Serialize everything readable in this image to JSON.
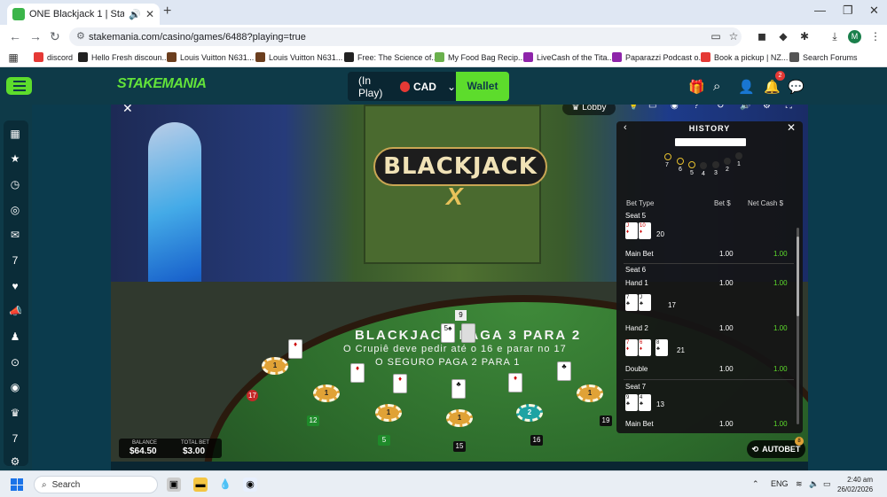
{
  "browser": {
    "tab_title": "ONE Blackjack 1 | StakeMan",
    "url": "stakemania.com/casino/games/6488?playing=true",
    "avatar_letter": "M",
    "bookmarks": [
      {
        "label": "discord",
        "color": "#e53935"
      },
      {
        "label": "Hello Fresh discoun...",
        "color": "#222222"
      },
      {
        "label": "Louis Vuitton N631...",
        "color": "#6b3e1e"
      },
      {
        "label": "Louis Vuitton N631...",
        "color": "#6b3e1e"
      },
      {
        "label": "Free: The Science of...",
        "color": "#222222"
      },
      {
        "label": "My Food Bag Recip...",
        "color": "#6ab04c"
      },
      {
        "label": "LiveCash of the Tita...",
        "color": "#8e24aa"
      },
      {
        "label": "Paparazzi Podcast o...",
        "color": "#8e24aa"
      },
      {
        "label": "Book a pickup | NZ...",
        "color": "#e53935"
      },
      {
        "label": "Search Forums",
        "color": "#555555"
      }
    ]
  },
  "site": {
    "logo": "STAKEMANIA",
    "balance_label": "(In Play)",
    "currency": "CAD",
    "wallet_label": "Wallet",
    "notification_count": "2",
    "accent": "#5ddc2c"
  },
  "game": {
    "lobby_label": "Lobby",
    "logo_text": "BLACKJACK",
    "logo_x": "X",
    "table_line1": "BLACKJACK PAGA 3 PARA 2",
    "table_line2": "O Crupiê deve pedir até o 16 e parar no 17",
    "table_line3": "O SEGURO PAGA 2 PARA 1",
    "dealer_total": "9",
    "seat_numbers": {
      "s17": "17",
      "s12": "12",
      "s5": "5",
      "s15": "15",
      "s16": "16",
      "s19": "19"
    },
    "balance_label": "BALANCE",
    "balance_value": "$64.50",
    "total_bet_label": "TOTAL BET",
    "total_bet_value": "$3.00",
    "autobet_label": "AUTOBET",
    "autobet_badge": "8",
    "chip_value": "1",
    "chip_value_teal": "2"
  },
  "history": {
    "title": "HISTORY",
    "dots": [
      {
        "label": "7",
        "type": "y"
      },
      {
        "label": "6",
        "type": "y"
      },
      {
        "label": "5",
        "type": "y"
      },
      {
        "label": "4",
        "type": "k"
      },
      {
        "label": "3",
        "type": "k"
      },
      {
        "label": "2",
        "type": "k"
      },
      {
        "label": "1",
        "type": "k"
      }
    ],
    "col_bet_type": "Bet Type",
    "col_bet": "Bet $",
    "col_net": "Net Cash $",
    "seat5": {
      "label": "Seat 5",
      "cards": [
        {
          "rank": "J",
          "suit": "♦",
          "red": true
        },
        {
          "rank": "10",
          "suit": "♦",
          "red": true
        }
      ],
      "total": "20",
      "bet_type": "Main Bet",
      "bet": "1.00",
      "net": "1.00"
    },
    "seat6": {
      "label": "Seat 6",
      "hand1": {
        "label": "Hand 1",
        "bet": "1.00",
        "net": "1.00",
        "cards": [
          {
            "rank": "7",
            "suit": "♣",
            "red": false
          },
          {
            "rank": "J",
            "suit": "♣",
            "red": false
          }
        ],
        "total": "17"
      },
      "hand2": {
        "label": "Hand 2",
        "bet": "1.00",
        "net": "1.00",
        "cards": [
          {
            "rank": "7",
            "suit": "♦",
            "red": true
          },
          {
            "rank": "6",
            "suit": "♦",
            "red": true
          },
          {
            "rank": "8",
            "suit": "♣",
            "red": false
          }
        ],
        "total": "21",
        "bet_type": "Double",
        "bet2": "1.00",
        "net2": "1.00"
      }
    },
    "seat7": {
      "label": "Seat 7",
      "cards": [
        {
          "rank": "9",
          "suit": "♣",
          "red": false
        },
        {
          "rank": "4",
          "suit": "♣",
          "red": false
        }
      ],
      "total": "13",
      "bet_type": "Main Bet",
      "bet": "1.00",
      "net": "1.00"
    }
  },
  "taskbar": {
    "search_label": "Search",
    "lang": "ENG",
    "time": "2:40 am",
    "date": "26/02/2026"
  }
}
